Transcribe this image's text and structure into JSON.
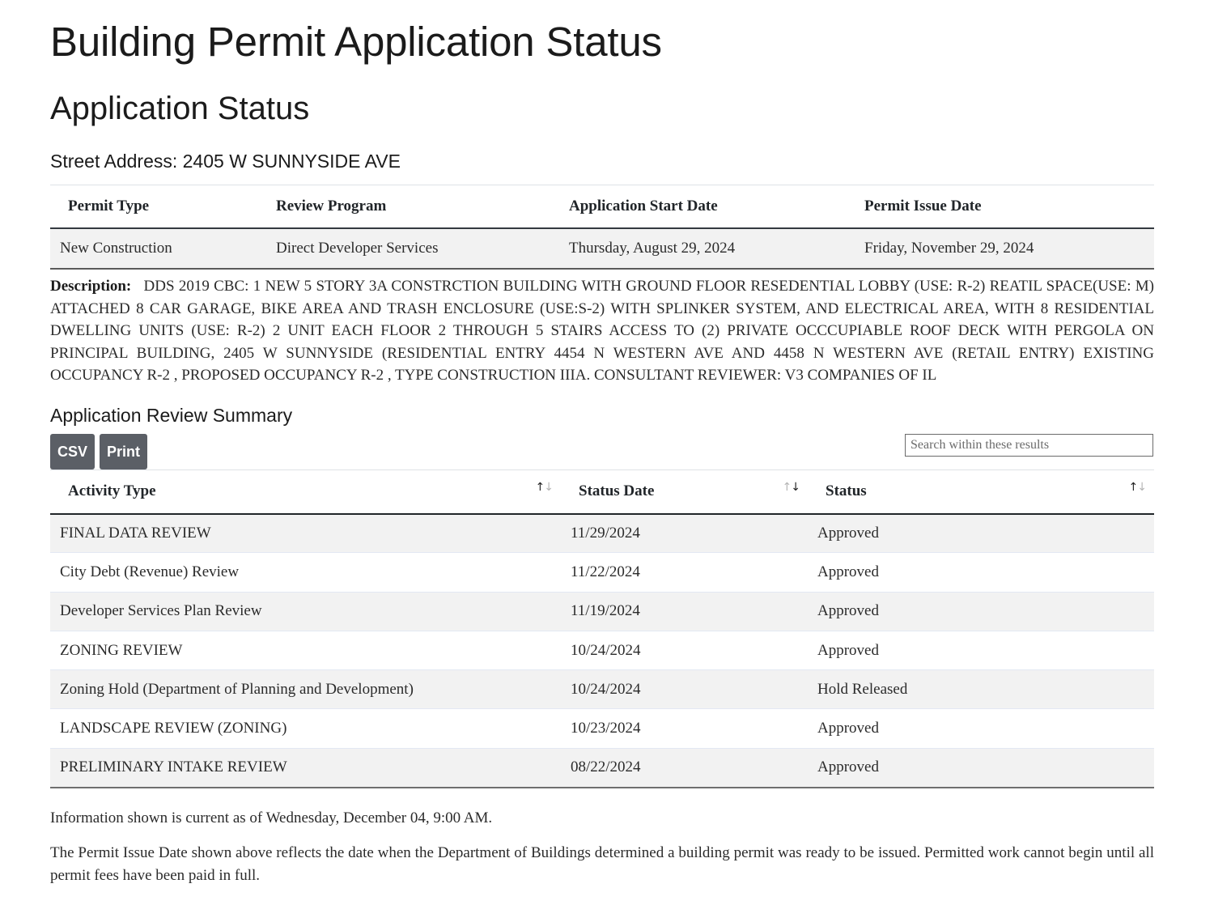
{
  "page": {
    "title": "Building Permit Application Status",
    "section_title": "Application Status",
    "street_address": "Street Address: 2405 W SUNNYSIDE AVE"
  },
  "permit_info": {
    "headers": [
      "Permit Type",
      "Review Program",
      "Application Start Date",
      "Permit Issue Date"
    ],
    "values": [
      "New Construction",
      "Direct Developer Services",
      "Thursday, August 29, 2024",
      "Friday, November 29, 2024"
    ]
  },
  "description": {
    "label": "Description:",
    "text": "DDS 2019 CBC: 1 NEW 5 STORY 3A CONSTRCTION BUILDING WITH GROUND FLOOR RESEDENTIAL LOBBY (USE: R-2) REATIL SPACE(USE: M) ATTACHED 8 CAR GARAGE, BIKE AREA AND TRASH ENCLOSURE (USE:S-2) WITH SPLINKER SYSTEM, AND ELECTRICAL AREA, WITH 8 RESIDENTIAL DWELLING UNITS (USE: R-2) 2 UNIT EACH FLOOR 2 THROUGH 5 STAIRS ACCESS TO (2) PRIVATE OCCCUPIABLE ROOF DECK WITH PERGOLA ON PRINCIPAL BUILDING, 2405 W SUNNYSIDE (RESIDENTIAL ENTRY 4454 N WESTERN AVE AND 4458 N WESTERN AVE (RETAIL ENTRY) EXISTING OCCUPANCY R-2 , PROPOSED OCCUPANCY R-2 , TYPE CONSTRUCTION IIIA. CONSULTANT REVIEWER: V3 COMPANIES OF IL"
  },
  "review_summary": {
    "title": "Application Review Summary",
    "buttons": {
      "csv": "CSV",
      "print": "Print"
    },
    "search": {
      "placeholder": "Search within these results",
      "value": ""
    },
    "sort_glyphs": {
      "up": "↑",
      "down": "↓"
    },
    "columns": [
      {
        "label": "Activity Type",
        "sort": "ascending"
      },
      {
        "label": "Status Date",
        "sort": "descending"
      },
      {
        "label": "Status",
        "sort": "ascending"
      }
    ],
    "rows": [
      {
        "activity": "FINAL DATA REVIEW",
        "date": "11/29/2024",
        "status": "Approved"
      },
      {
        "activity": "City Debt (Revenue) Review",
        "date": "11/22/2024",
        "status": "Approved"
      },
      {
        "activity": "Developer Services Plan Review",
        "date": "11/19/2024",
        "status": "Approved"
      },
      {
        "activity": "ZONING REVIEW",
        "date": "10/24/2024",
        "status": "Approved"
      },
      {
        "activity": "Zoning Hold (Department of Planning and Development)",
        "date": "10/24/2024",
        "status": "Hold Released"
      },
      {
        "activity": "LANDSCAPE REVIEW (ZONING)",
        "date": "10/23/2024",
        "status": "Approved"
      },
      {
        "activity": "PRELIMINARY INTAKE REVIEW",
        "date": "08/22/2024",
        "status": "Approved"
      }
    ]
  },
  "footer": {
    "current_as_of": "Information shown is current as of Wednesday, December 04, 9:00 AM.",
    "disclaimer": "The Permit Issue Date shown above reflects the date when the Department of Buildings determined a building permit was ready to be issued. Permitted work cannot begin until all permit fees have been paid in full."
  },
  "colors": {
    "button_bg": "#5b5f66",
    "row_stripe": "#f2f2f2",
    "text": "#212529"
  }
}
